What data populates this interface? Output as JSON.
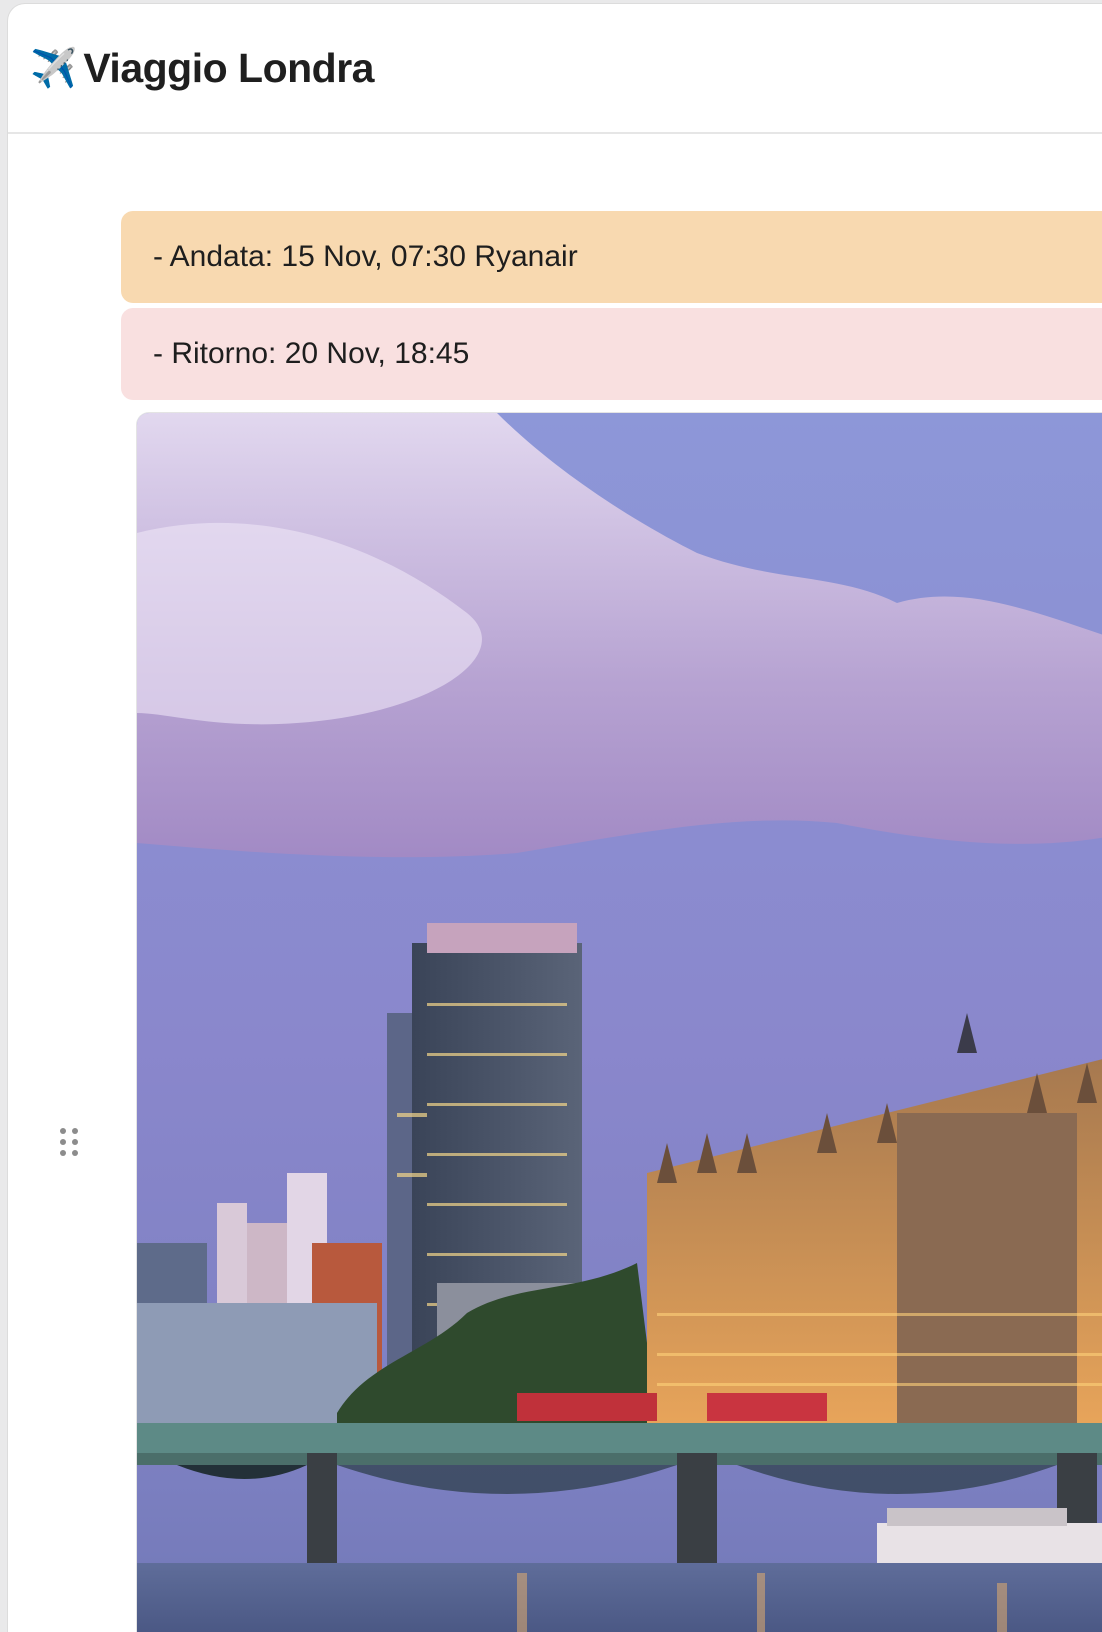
{
  "header": {
    "icon": "airplane-icon",
    "icon_glyph": "✈️",
    "title": "Viaggio Londra"
  },
  "blocks": [
    {
      "text": "- Andata: 15 Nov, 07:30 Ryanair",
      "color": "#f8d9b0"
    },
    {
      "text": "- Ritorno: 20 Nov, 18:45",
      "color": "#f9e0e0"
    }
  ],
  "image": {
    "subject": "london-westminster-photo"
  },
  "drag_handle": {
    "icon": "drag-handle-icon"
  }
}
